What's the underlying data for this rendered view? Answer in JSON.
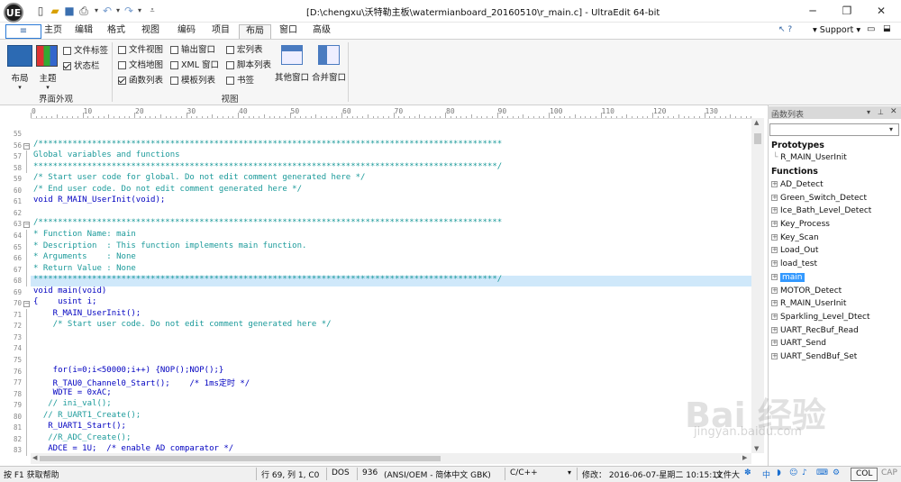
{
  "window": {
    "logo": "UE",
    "title": "[D:\\chengxu\\沃特勒主板\\watermianboard_20160510\\r_main.c] - UltraEdit 64-bit",
    "controls": [
      "minimize",
      "restore",
      "close"
    ]
  },
  "ribbon": {
    "tabs": [
      "主页",
      "编辑",
      "格式",
      "视图",
      "编码",
      "项目",
      "布局",
      "窗口",
      "高级"
    ],
    "active_tab": "布局",
    "help": "?",
    "support": "Support",
    "group_ui": {
      "label": "界面外观",
      "layout_btn": "布局",
      "theme_btn": "主题",
      "checks": [
        {
          "label": "文件标签",
          "checked": false
        },
        {
          "label": "状态栏",
          "checked": true
        }
      ]
    },
    "group_view": {
      "label": "视图",
      "col1": [
        {
          "label": "文件视图",
          "checked": false
        },
        {
          "label": "文档地图",
          "checked": false
        },
        {
          "label": "函数列表",
          "checked": true
        }
      ],
      "col2": [
        {
          "label": "输出窗口",
          "checked": false
        },
        {
          "label": "XML 窗口",
          "checked": false
        },
        {
          "label": "模板列表",
          "checked": false
        }
      ],
      "col3": [
        {
          "label": "宏列表",
          "checked": false
        },
        {
          "label": "脚本列表",
          "checked": false
        },
        {
          "label": "书签",
          "checked": false
        }
      ],
      "other_btn": "其他窗口",
      "merge_btn": "合并窗口"
    }
  },
  "editor": {
    "ruler": [
      "0",
      "10",
      "20",
      "30",
      "40",
      "50",
      "60",
      "70",
      "80",
      "90",
      "100",
      "110",
      "120",
      "130"
    ],
    "lines": [
      {
        "n": "55",
        "text": ""
      },
      {
        "n": "56",
        "text": "/***********************************************************************************************"
      },
      {
        "n": "57",
        "text": "Global variables and functions"
      },
      {
        "n": "58",
        "text": "***********************************************************************************************/"
      },
      {
        "n": "59",
        "text": "/* Start user code for global. Do not edit comment generated here */"
      },
      {
        "n": "60",
        "text": "/* End user code. Do not edit comment generated here */"
      },
      {
        "n": "61",
        "text": "void R_MAIN_UserInit(void);"
      },
      {
        "n": "62",
        "text": ""
      },
      {
        "n": "63",
        "text": "/***********************************************************************************************"
      },
      {
        "n": "64",
        "text": "* Function Name: main"
      },
      {
        "n": "65",
        "text": "* Description  : This function implements main function."
      },
      {
        "n": "66",
        "text": "* Arguments    : None"
      },
      {
        "n": "67",
        "text": "* Return Value : None"
      },
      {
        "n": "68",
        "text": "***********************************************************************************************/"
      },
      {
        "n": "69",
        "text": "void main(void)"
      },
      {
        "n": "70",
        "text": "{    usint i;"
      },
      {
        "n": "71",
        "text": "    R_MAIN_UserInit();"
      },
      {
        "n": "72",
        "text": "    /* Start user code. Do not edit comment generated here */"
      },
      {
        "n": "73",
        "text": ""
      },
      {
        "n": "74",
        "text": ""
      },
      {
        "n": "75",
        "text": ""
      },
      {
        "n": "76",
        "text": "    for(i=0;i<50000;i++) {NOP();NOP();}"
      },
      {
        "n": "77",
        "text": "    R_TAU0_Channel0_Start();    /* 1ms定时 */"
      },
      {
        "n": "78",
        "text": "    WDTE = 0xAC;"
      },
      {
        "n": "79",
        "text": "   // ini_val();"
      },
      {
        "n": "80",
        "text": "  // R_UART1_Create();"
      },
      {
        "n": "81",
        "text": "   R_UART1_Start();"
      },
      {
        "n": "82",
        "text": "   //R_ADC_Create();"
      },
      {
        "n": "83",
        "text": "   ADCE = 1U;  /* enable AD comparator */"
      }
    ]
  },
  "function_panel": {
    "title": "函数列表",
    "prototypes_label": "Prototypes",
    "prototypes": [
      "R_MAIN_UserInit"
    ],
    "functions_label": "Functions",
    "functions": [
      "AD_Detect",
      "Green_Switch_Detect",
      "Ice_Bath_Level_Detect",
      "Key_Process",
      "Key_Scan",
      "Load_Out",
      "load_test",
      "main",
      "MOTOR_Detect",
      "R_MAIN_UserInit",
      "Sparkling_Level_Dtect",
      "UART_RecBuf_Read",
      "UART_Send",
      "UART_SendBuf_Set"
    ],
    "selected": "main"
  },
  "status": {
    "help": "按 F1 获取帮助",
    "position": "行 69, 列 1, C0",
    "line_ending": "DOS",
    "codepage": "936",
    "encoding": "(ANSI/OEM - 简体中文 GBK)",
    "language": "C/C++",
    "modified": "修改：  2016-06-07-星期二 10:15:11",
    "size": "文件大",
    "ime": "中",
    "col": "COL",
    "cap": "CAP"
  },
  "watermark": {
    "brand": "Bai 经验",
    "url": "jingyan.baidu.com"
  }
}
